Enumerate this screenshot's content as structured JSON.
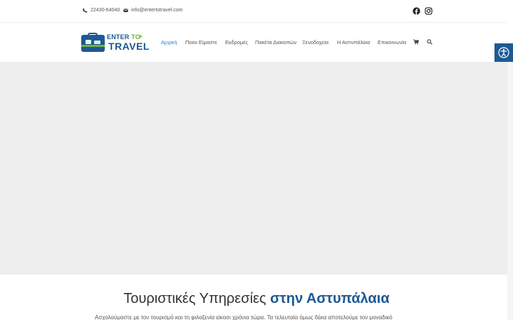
{
  "topbar": {
    "phone": "22430-64040",
    "email": "info@entertotravel.com"
  },
  "logo": {
    "line1_a": "ENTER",
    "line1_b": "TO",
    "line2": "TRAVEL"
  },
  "nav": {
    "items": [
      {
        "label": "Αρχική",
        "active": true
      },
      {
        "label": "Ποιοι Είμαστε"
      },
      {
        "label": "Εκδρομές"
      },
      {
        "label": "Πακέτα Διακοπών"
      },
      {
        "label": "Ξενοδοχεία"
      },
      {
        "label": "Η Αστυπάλαια"
      },
      {
        "label": "Επικοινωνία"
      }
    ]
  },
  "section": {
    "title_plain": "Τουριστικές Υπηρεσίες",
    "title_accent": "στην Αστυπάλαια",
    "intro": "Ασχολούμαστε με τον τουρισμό και τη φιλοξενία είκοσι χρόνια τώρα. Τα τελευταία όμως δέκα αποτελούμε τον μοναδικό"
  },
  "colors": {
    "brand": "#1c5a93",
    "accent_green": "#6fb240",
    "nav_active": "#2e7cc1",
    "hero_bg": "#eeeeee"
  },
  "icons": [
    "phone-icon",
    "envelope-icon",
    "facebook-icon",
    "instagram-icon",
    "cart-icon",
    "search-icon",
    "accessibility-icon"
  ]
}
